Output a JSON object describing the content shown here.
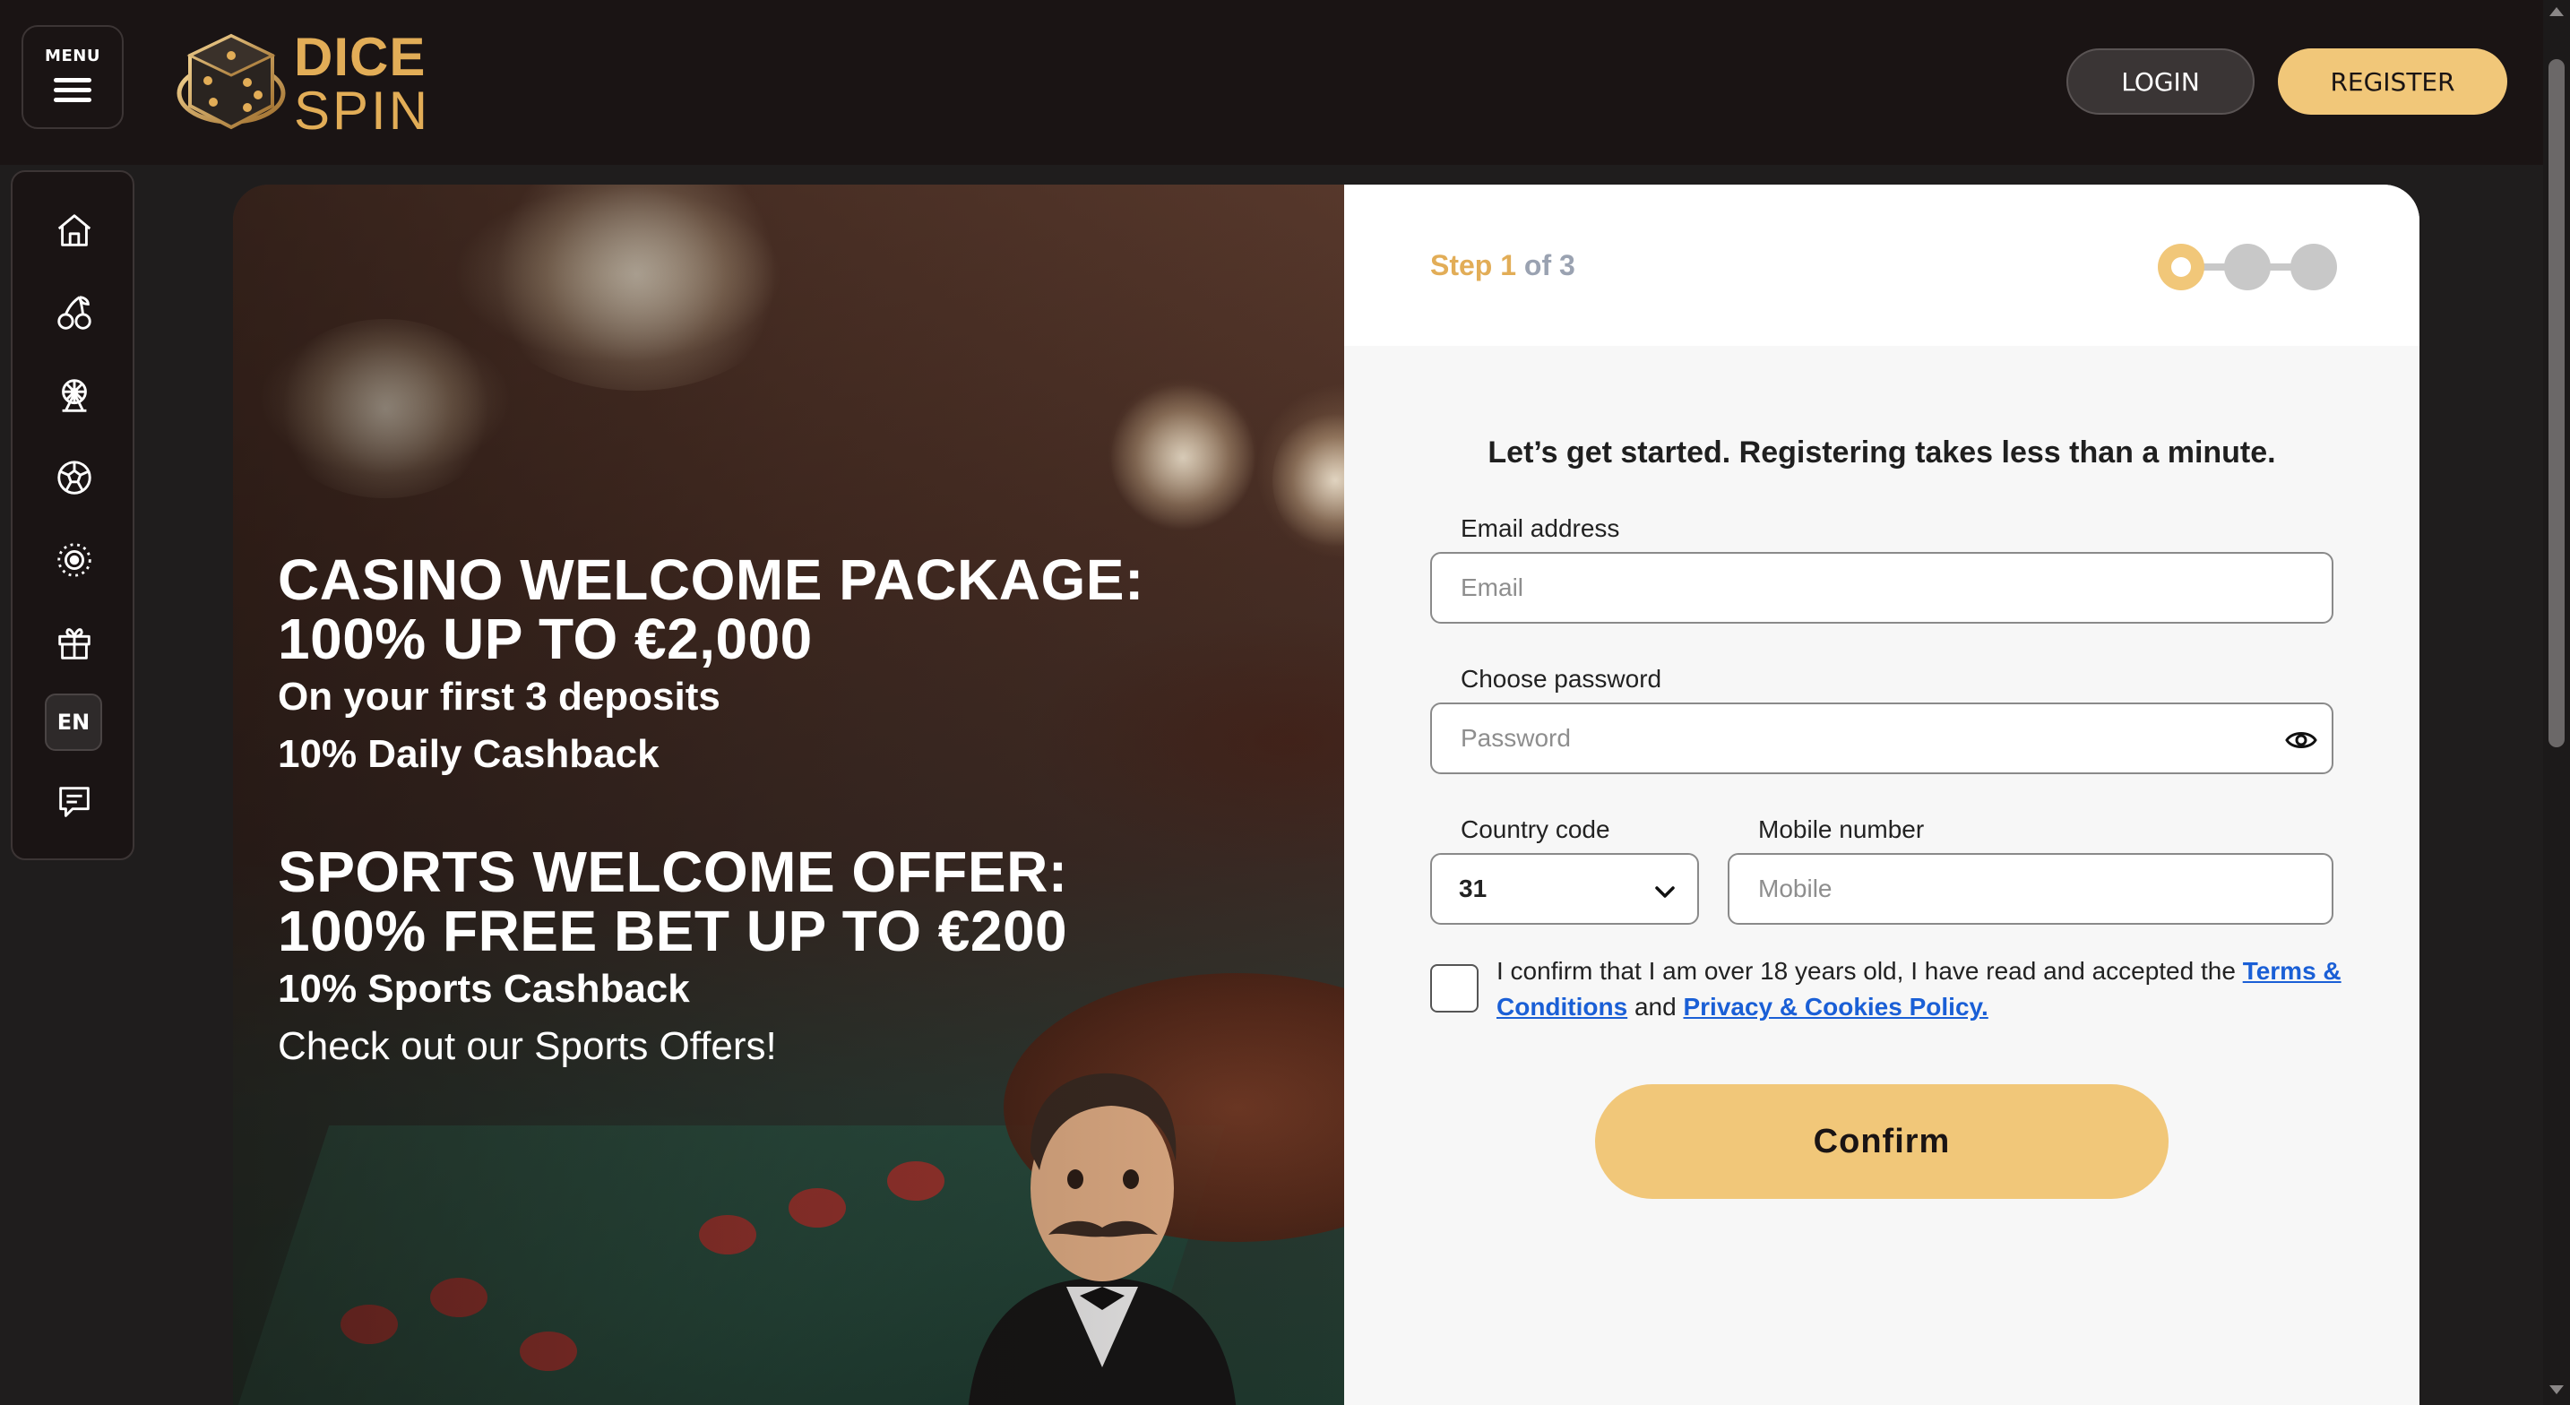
{
  "header": {
    "menu_label": "MENU",
    "logo_line1": "DICE",
    "logo_line2": "SPIN",
    "login_label": "LOGIN",
    "register_label": "REGISTER"
  },
  "sidebar": {
    "items": [
      {
        "icon": "home-icon"
      },
      {
        "icon": "cherries-icon"
      },
      {
        "icon": "ferris-wheel-icon"
      },
      {
        "icon": "soccer-ball-icon"
      },
      {
        "icon": "target-icon"
      },
      {
        "icon": "gift-icon"
      },
      {
        "icon": "language-icon"
      },
      {
        "icon": "chat-icon"
      }
    ],
    "language": "EN"
  },
  "promo": {
    "casino_title_line1": "CASINO WELCOME PACKAGE:",
    "casino_title_line2": "100% UP TO €2,000",
    "casino_sub1": "On your first 3 deposits",
    "casino_sub2": "10% Daily Cashback",
    "sports_title_line1": "SPORTS WELCOME OFFER:",
    "sports_title_line2": "100% FREE BET UP TO €200",
    "sports_sub1": "10% Sports Cashback",
    "sports_sub2": "Check out our Sports Offers!"
  },
  "form": {
    "step_word": "Step",
    "step_current": "1",
    "step_rest": "of 3",
    "intro": "Let’s get started. Registering takes less than a minute.",
    "email_label": "Email address",
    "email_placeholder": "Email",
    "password_label": "Choose password",
    "password_placeholder": "Password",
    "country_label": "Country code",
    "country_value": "31",
    "mobile_label": "Mobile number",
    "mobile_placeholder": "Mobile",
    "consent_prefix": "I confirm that I am over 18 years old, I have read and accepted the ",
    "terms_link": "Terms & Conditions",
    "consent_and": " and ",
    "privacy_link": "Privacy & Cookies Policy.",
    "confirm_label": "Confirm"
  },
  "colors": {
    "accent": "#f1c779",
    "brand_gold": "#e2ad57",
    "header_bg": "#1a1414",
    "link": "#1a5fd6"
  }
}
